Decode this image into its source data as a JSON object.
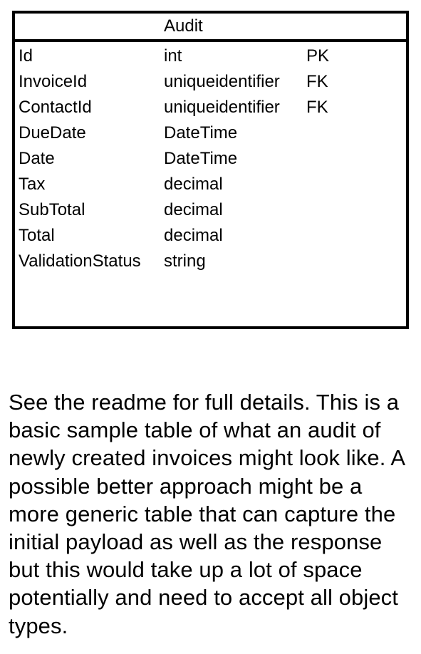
{
  "entity": {
    "title": "Audit",
    "rows": [
      {
        "name": "Id",
        "type": "int",
        "key": "PK"
      },
      {
        "name": "InvoiceId",
        "type": "uniqueidentifier",
        "key": "FK"
      },
      {
        "name": "ContactId",
        "type": "uniqueidentifier",
        "key": "FK"
      },
      {
        "name": "DueDate",
        "type": "DateTime",
        "key": ""
      },
      {
        "name": "Date",
        "type": "DateTime",
        "key": ""
      },
      {
        "name": "Tax",
        "type": "decimal",
        "key": ""
      },
      {
        "name": "SubTotal",
        "type": "decimal",
        "key": ""
      },
      {
        "name": "Total",
        "type": "decimal",
        "key": ""
      },
      {
        "name": "ValidationStatus",
        "type": "string",
        "key": ""
      }
    ]
  },
  "note": "See the readme for full details. This is a basic sample table of what an audit of newly created invoices might look like. A possible better approach might be a more generic table that can capture the initial payload as well as the response but this would take up a lot of space potentially and need to accept all object types."
}
